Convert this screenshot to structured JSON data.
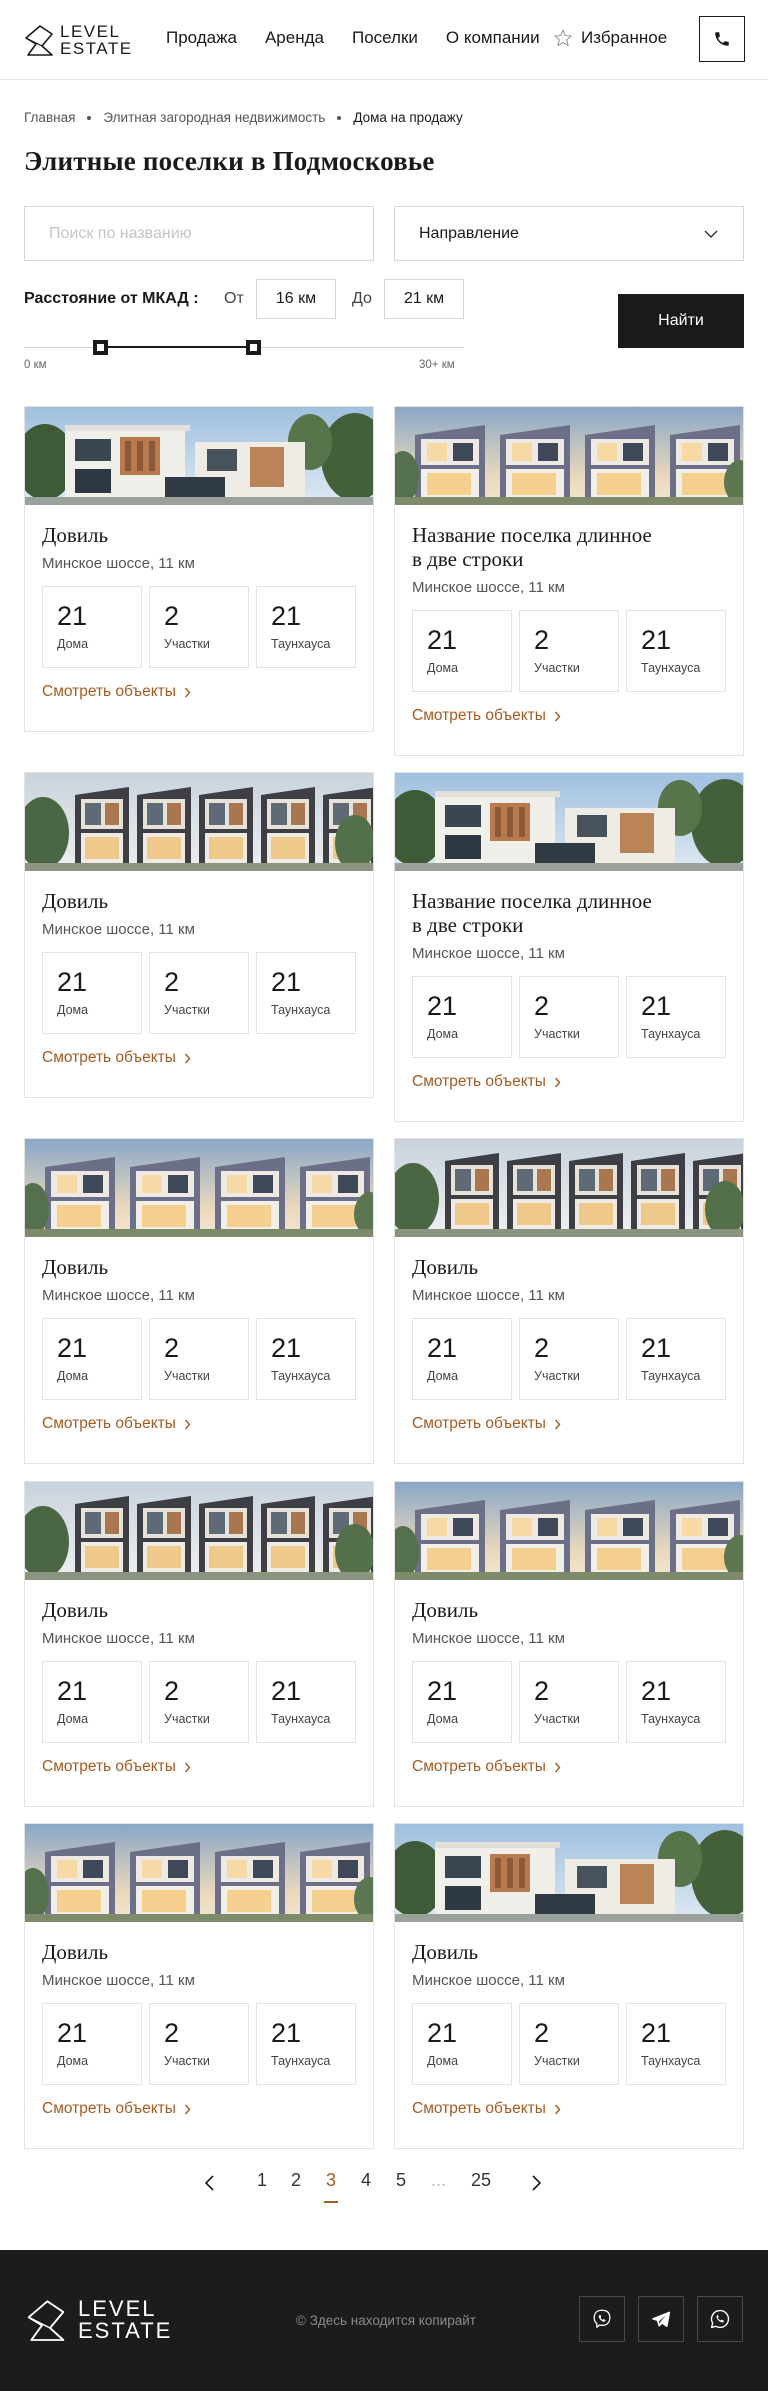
{
  "brand": {
    "line1": "LEVEL",
    "line2": "ESTATE"
  },
  "nav": [
    {
      "label": "Продажа"
    },
    {
      "label": "Аренда"
    },
    {
      "label": "Поселки"
    },
    {
      "label": "О компании"
    }
  ],
  "favorites_label": "Избранное",
  "icons": {
    "favorites": "star-icon",
    "phone": "phone-icon",
    "chevron": "chevron-right-icon"
  },
  "colors": {
    "accent": "#a55a1f",
    "dark": "#1c1c1c"
  },
  "breadcrumb": [
    "Главная",
    "Элитная загородная недвижимость",
    "Дома на продажу"
  ],
  "page_title": "Элитные поселки в Подмосковье",
  "filter": {
    "search_placeholder": "Поиск по названию",
    "direction_label": "Направление",
    "distance_label": "Расстояние от МКАД :",
    "from_label": "От",
    "from_value": "16 км",
    "to_label": "До",
    "to_value": "21 км",
    "range_min_label": "0 км",
    "range_max_label": "30+ км",
    "find_label": "Найти"
  },
  "stat_labels": {
    "houses": "Дома",
    "plots": "Участки",
    "townhouses": "Таунхауса"
  },
  "link_label": "Смотреть объекты",
  "cards": [
    {
      "name_lines": [
        "Довиль"
      ],
      "road": "Минское шоссе, 11 км",
      "houses": "21",
      "plots": "2",
      "townhouses": "21"
    },
    {
      "name_lines": [
        "Название поселка длинное",
        "в две строки"
      ],
      "road": "Минское шоссе, 11 км",
      "houses": "21",
      "plots": "2",
      "townhouses": "21"
    },
    {
      "name_lines": [
        "Довиль"
      ],
      "road": "Минское шоссе, 11 км",
      "houses": "21",
      "plots": "2",
      "townhouses": "21"
    },
    {
      "name_lines": [
        "Название поселка длинное",
        "в две строки"
      ],
      "road": "Минское шоссе, 11 км",
      "houses": "21",
      "plots": "2",
      "townhouses": "21"
    },
    {
      "name_lines": [
        "Довиль"
      ],
      "road": "Минское шоссе, 11 км",
      "houses": "21",
      "plots": "2",
      "townhouses": "21"
    },
    {
      "name_lines": [
        "Довиль"
      ],
      "road": "Минское шоссе, 11 км",
      "houses": "21",
      "plots": "2",
      "townhouses": "21"
    },
    {
      "name_lines": [
        "Довиль"
      ],
      "road": "Минское шоссе, 11 км",
      "houses": "21",
      "plots": "2",
      "townhouses": "21"
    },
    {
      "name_lines": [
        "Довиль"
      ],
      "road": "Минское шоссе, 11 км",
      "houses": "21",
      "plots": "2",
      "townhouses": "21"
    },
    {
      "name_lines": [
        "Довиль"
      ],
      "road": "Минское шоссе, 11 км",
      "houses": "21",
      "plots": "2",
      "townhouses": "21"
    },
    {
      "name_lines": [
        "Довиль"
      ],
      "road": "Минское шоссе, 11 км",
      "houses": "21",
      "plots": "2",
      "townhouses": "21"
    }
  ],
  "pagination": {
    "pages": [
      "1",
      "2",
      "3",
      "4",
      "5",
      "...",
      "25"
    ],
    "current": "3"
  },
  "footer": {
    "copyright": "© Здесь находится копирайт",
    "socials": [
      "viber-icon",
      "telegram-icon",
      "whatsapp-icon"
    ]
  }
}
